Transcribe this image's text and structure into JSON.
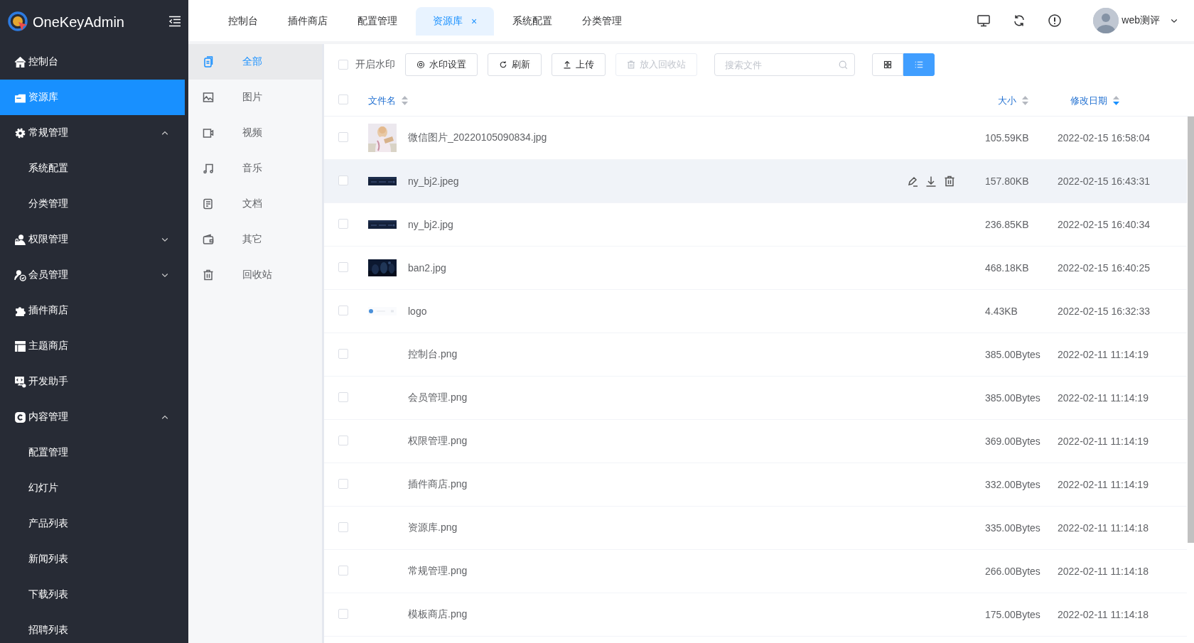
{
  "brand": {
    "name": "OneKeyAdmin"
  },
  "sidebar": {
    "items": [
      {
        "label": "控制台",
        "selected": false
      },
      {
        "label": "资源库",
        "selected": true
      },
      {
        "label": "常规管理",
        "selected": false,
        "expanded": true,
        "children": [
          {
            "label": "系统配置",
            "selected": false
          },
          {
            "label": "分类管理",
            "selected": false
          }
        ]
      },
      {
        "label": "权限管理",
        "selected": false,
        "expanded": false
      },
      {
        "label": "会员管理",
        "selected": false,
        "expanded": false
      },
      {
        "label": "插件商店",
        "selected": false
      },
      {
        "label": "主题商店",
        "selected": false
      },
      {
        "label": "开发助手",
        "selected": false
      },
      {
        "label": "内容管理",
        "selected": false,
        "expanded": true,
        "children": [
          {
            "label": "配置管理",
            "selected": false
          },
          {
            "label": "幻灯片",
            "selected": false
          },
          {
            "label": "产品列表",
            "selected": false
          },
          {
            "label": "新闻列表",
            "selected": false
          },
          {
            "label": "下载列表",
            "selected": false
          },
          {
            "label": "招聘列表",
            "selected": false
          }
        ]
      }
    ]
  },
  "tabs": [
    {
      "label": "控制台",
      "selected": false
    },
    {
      "label": "插件商店",
      "selected": false
    },
    {
      "label": "配置管理",
      "selected": false
    },
    {
      "label": "资源库",
      "selected": true,
      "close": "×"
    },
    {
      "label": "系统配置",
      "selected": false
    },
    {
      "label": "分类管理",
      "selected": false
    }
  ],
  "user": {
    "name": "web测评"
  },
  "categories": [
    {
      "label": "全部",
      "selected": true
    },
    {
      "label": "图片",
      "selected": false
    },
    {
      "label": "视频",
      "selected": false
    },
    {
      "label": "音乐",
      "selected": false
    },
    {
      "label": "文档",
      "selected": false
    },
    {
      "label": "其它",
      "selected": false
    },
    {
      "label": "回收站",
      "selected": false
    }
  ],
  "toolbar": {
    "watermark": {
      "label": "开启水印",
      "checked": false
    },
    "buttons": [
      {
        "label": "水印设置",
        "disabled": false
      },
      {
        "label": "刷新",
        "disabled": false
      },
      {
        "label": "上传",
        "disabled": false
      },
      {
        "label": "放入回收站",
        "disabled": true
      }
    ],
    "search": {
      "placeholder": "搜索文件"
    },
    "views": [
      {
        "selected": false
      },
      {
        "selected": true
      }
    ]
  },
  "table": {
    "all_checked": false,
    "columns": [
      {
        "label": "文件名",
        "sorted": false
      },
      {
        "label": "大小",
        "sorted": false
      },
      {
        "label": "修改日期",
        "sorted": true
      }
    ],
    "rows": [
      {
        "name": "微信图片_20220105090834.jpg",
        "size": "105.59KB",
        "date": "2022-02-15 16:58:04",
        "checked": false,
        "hovered": false,
        "thumbnail": true
      },
      {
        "name": "ny_bj2.jpeg",
        "size": "157.80KB",
        "date": "2022-02-15 16:43:31",
        "checked": false,
        "hovered": true,
        "thumbnail": true
      },
      {
        "name": "ny_bj2.jpg",
        "size": "236.85KB",
        "date": "2022-02-15 16:40:34",
        "checked": false,
        "hovered": false,
        "thumbnail": true
      },
      {
        "name": "ban2.jpg",
        "size": "468.18KB",
        "date": "2022-02-15 16:40:25",
        "checked": false,
        "hovered": false,
        "thumbnail": true
      },
      {
        "name": "logo",
        "size": "4.43KB",
        "date": "2022-02-15 16:32:33",
        "checked": false,
        "hovered": false,
        "thumbnail": true
      },
      {
        "name": "控制台.png",
        "size": "385.00Bytes",
        "date": "2022-02-11 11:14:19",
        "checked": false,
        "hovered": false,
        "thumbnail": false
      },
      {
        "name": "会员管理.png",
        "size": "385.00Bytes",
        "date": "2022-02-11 11:14:19",
        "checked": false,
        "hovered": false,
        "thumbnail": false
      },
      {
        "name": "权限管理.png",
        "size": "369.00Bytes",
        "date": "2022-02-11 11:14:19",
        "checked": false,
        "hovered": false,
        "thumbnail": false
      },
      {
        "name": "插件商店.png",
        "size": "332.00Bytes",
        "date": "2022-02-11 11:14:19",
        "checked": false,
        "hovered": false,
        "thumbnail": false
      },
      {
        "name": "资源库.png",
        "size": "335.00Bytes",
        "date": "2022-02-11 11:14:18",
        "checked": false,
        "hovered": false,
        "thumbnail": false
      },
      {
        "name": "常规管理.png",
        "size": "266.00Bytes",
        "date": "2022-02-11 11:14:18",
        "checked": false,
        "hovered": false,
        "thumbnail": false
      },
      {
        "name": "模板商店.png",
        "size": "175.00Bytes",
        "date": "2022-02-11 11:14:18",
        "checked": false,
        "hovered": false,
        "thumbnail": false
      }
    ]
  }
}
